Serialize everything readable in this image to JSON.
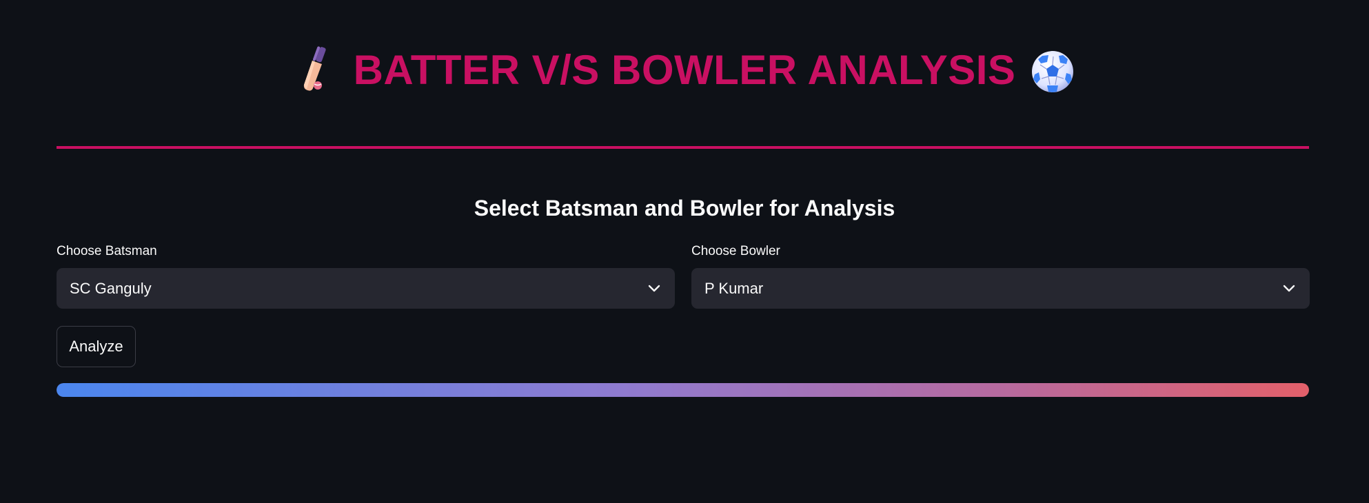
{
  "header": {
    "title": "BATTER V/S BOWLER ANALYSIS",
    "left_icon": "cricket-bat-icon",
    "right_icon": "soccer-ball-icon"
  },
  "theme": {
    "accent": "#c91062",
    "background": "#0e1117",
    "input_background": "#262730",
    "text": "#fafafa",
    "progress_start": "#4b86ee",
    "progress_end": "#e2606a"
  },
  "section": {
    "heading": "Select Batsman and Bowler for Analysis"
  },
  "batsman": {
    "label": "Choose Batsman",
    "selected": "SC Ganguly",
    "icon": "chevron-down-icon"
  },
  "bowler": {
    "label": "Choose Bowler",
    "selected": "P Kumar",
    "icon": "chevron-down-icon"
  },
  "actions": {
    "analyze_label": "Analyze"
  },
  "progress": {
    "value_percent": 100
  }
}
